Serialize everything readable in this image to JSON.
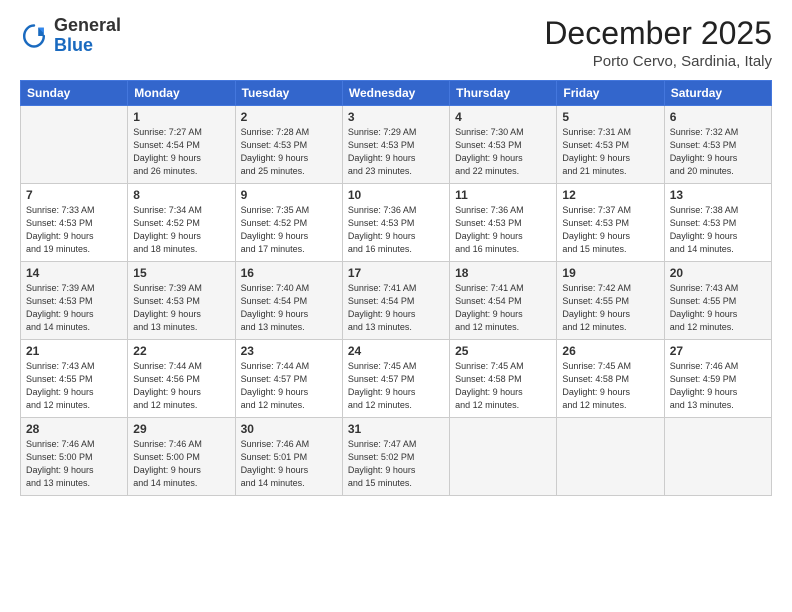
{
  "logo": {
    "line1": "General",
    "line2": "Blue"
  },
  "title": "December 2025",
  "location": "Porto Cervo, Sardinia, Italy",
  "days_of_week": [
    "Sunday",
    "Monday",
    "Tuesday",
    "Wednesday",
    "Thursday",
    "Friday",
    "Saturday"
  ],
  "weeks": [
    [
      {
        "day": "",
        "info": ""
      },
      {
        "day": "1",
        "info": "Sunrise: 7:27 AM\nSunset: 4:54 PM\nDaylight: 9 hours\nand 26 minutes."
      },
      {
        "day": "2",
        "info": "Sunrise: 7:28 AM\nSunset: 4:53 PM\nDaylight: 9 hours\nand 25 minutes."
      },
      {
        "day": "3",
        "info": "Sunrise: 7:29 AM\nSunset: 4:53 PM\nDaylight: 9 hours\nand 23 minutes."
      },
      {
        "day": "4",
        "info": "Sunrise: 7:30 AM\nSunset: 4:53 PM\nDaylight: 9 hours\nand 22 minutes."
      },
      {
        "day": "5",
        "info": "Sunrise: 7:31 AM\nSunset: 4:53 PM\nDaylight: 9 hours\nand 21 minutes."
      },
      {
        "day": "6",
        "info": "Sunrise: 7:32 AM\nSunset: 4:53 PM\nDaylight: 9 hours\nand 20 minutes."
      }
    ],
    [
      {
        "day": "7",
        "info": "Sunrise: 7:33 AM\nSunset: 4:53 PM\nDaylight: 9 hours\nand 19 minutes."
      },
      {
        "day": "8",
        "info": "Sunrise: 7:34 AM\nSunset: 4:52 PM\nDaylight: 9 hours\nand 18 minutes."
      },
      {
        "day": "9",
        "info": "Sunrise: 7:35 AM\nSunset: 4:52 PM\nDaylight: 9 hours\nand 17 minutes."
      },
      {
        "day": "10",
        "info": "Sunrise: 7:36 AM\nSunset: 4:53 PM\nDaylight: 9 hours\nand 16 minutes."
      },
      {
        "day": "11",
        "info": "Sunrise: 7:36 AM\nSunset: 4:53 PM\nDaylight: 9 hours\nand 16 minutes."
      },
      {
        "day": "12",
        "info": "Sunrise: 7:37 AM\nSunset: 4:53 PM\nDaylight: 9 hours\nand 15 minutes."
      },
      {
        "day": "13",
        "info": "Sunrise: 7:38 AM\nSunset: 4:53 PM\nDaylight: 9 hours\nand 14 minutes."
      }
    ],
    [
      {
        "day": "14",
        "info": "Sunrise: 7:39 AM\nSunset: 4:53 PM\nDaylight: 9 hours\nand 14 minutes."
      },
      {
        "day": "15",
        "info": "Sunrise: 7:39 AM\nSunset: 4:53 PM\nDaylight: 9 hours\nand 13 minutes."
      },
      {
        "day": "16",
        "info": "Sunrise: 7:40 AM\nSunset: 4:54 PM\nDaylight: 9 hours\nand 13 minutes."
      },
      {
        "day": "17",
        "info": "Sunrise: 7:41 AM\nSunset: 4:54 PM\nDaylight: 9 hours\nand 13 minutes."
      },
      {
        "day": "18",
        "info": "Sunrise: 7:41 AM\nSunset: 4:54 PM\nDaylight: 9 hours\nand 12 minutes."
      },
      {
        "day": "19",
        "info": "Sunrise: 7:42 AM\nSunset: 4:55 PM\nDaylight: 9 hours\nand 12 minutes."
      },
      {
        "day": "20",
        "info": "Sunrise: 7:43 AM\nSunset: 4:55 PM\nDaylight: 9 hours\nand 12 minutes."
      }
    ],
    [
      {
        "day": "21",
        "info": "Sunrise: 7:43 AM\nSunset: 4:55 PM\nDaylight: 9 hours\nand 12 minutes."
      },
      {
        "day": "22",
        "info": "Sunrise: 7:44 AM\nSunset: 4:56 PM\nDaylight: 9 hours\nand 12 minutes."
      },
      {
        "day": "23",
        "info": "Sunrise: 7:44 AM\nSunset: 4:57 PM\nDaylight: 9 hours\nand 12 minutes."
      },
      {
        "day": "24",
        "info": "Sunrise: 7:45 AM\nSunset: 4:57 PM\nDaylight: 9 hours\nand 12 minutes."
      },
      {
        "day": "25",
        "info": "Sunrise: 7:45 AM\nSunset: 4:58 PM\nDaylight: 9 hours\nand 12 minutes."
      },
      {
        "day": "26",
        "info": "Sunrise: 7:45 AM\nSunset: 4:58 PM\nDaylight: 9 hours\nand 12 minutes."
      },
      {
        "day": "27",
        "info": "Sunrise: 7:46 AM\nSunset: 4:59 PM\nDaylight: 9 hours\nand 13 minutes."
      }
    ],
    [
      {
        "day": "28",
        "info": "Sunrise: 7:46 AM\nSunset: 5:00 PM\nDaylight: 9 hours\nand 13 minutes."
      },
      {
        "day": "29",
        "info": "Sunrise: 7:46 AM\nSunset: 5:00 PM\nDaylight: 9 hours\nand 14 minutes."
      },
      {
        "day": "30",
        "info": "Sunrise: 7:46 AM\nSunset: 5:01 PM\nDaylight: 9 hours\nand 14 minutes."
      },
      {
        "day": "31",
        "info": "Sunrise: 7:47 AM\nSunset: 5:02 PM\nDaylight: 9 hours\nand 15 minutes."
      },
      {
        "day": "",
        "info": ""
      },
      {
        "day": "",
        "info": ""
      },
      {
        "day": "",
        "info": ""
      }
    ]
  ]
}
